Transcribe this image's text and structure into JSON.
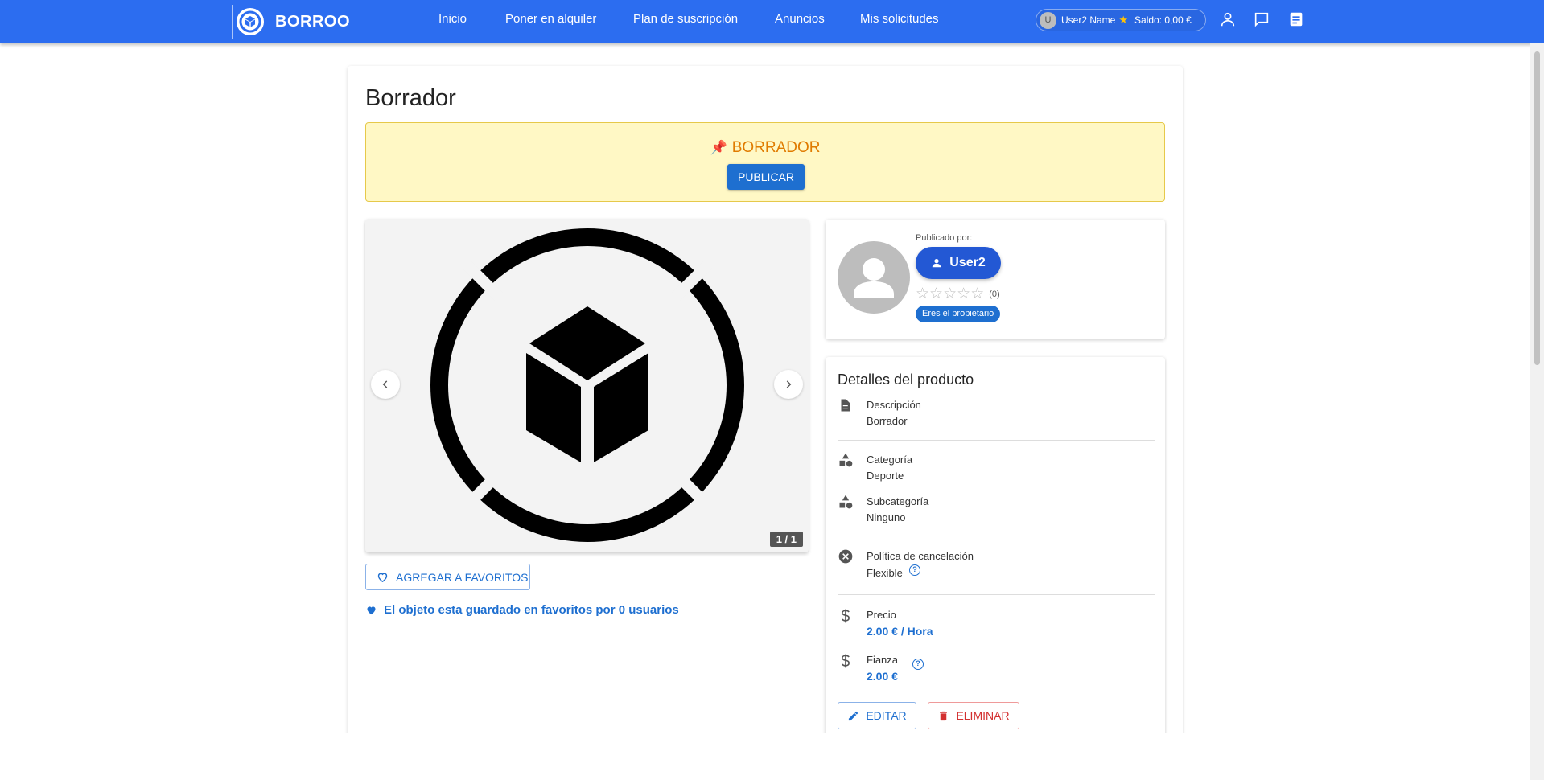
{
  "header": {
    "brand": "BORROO",
    "nav": [
      "Inicio",
      "Poner en alquiler",
      "Plan de suscripción",
      "Anuncios",
      "Mis solicitudes"
    ],
    "user_initial": "U",
    "user_name": "User2 Name",
    "balance": "Saldo: 0,00 €",
    "icons": [
      "person-icon",
      "chat-icon",
      "notes-icon"
    ]
  },
  "page": {
    "title": "Borrador",
    "draft_label": "BORRADOR",
    "publish_label": "PUBLICAR"
  },
  "carousel": {
    "counter": "1 / 1"
  },
  "favorites": {
    "button_label": "AGREGAR A FAVORITOS",
    "info": "El objeto esta guardado en favoritos por 0 usuarios"
  },
  "owner": {
    "published_by": "Publicado por:",
    "username": "User2",
    "rating": 0,
    "rating_count": "(0)",
    "badge": "Eres el propietario"
  },
  "details": {
    "title": "Detalles del producto",
    "description_label": "Descripción",
    "description_value": "Borrador",
    "category_label": "Categoría",
    "category_value": "Deporte",
    "subcategory_label": "Subcategoría",
    "subcategory_value": "Ninguno",
    "cancellation_label": "Política de cancelación",
    "cancellation_value": "Flexible",
    "price_label": "Precio",
    "price_value": "2.00 € / Hora",
    "deposit_label": "Fianza",
    "deposit_value": "2.00 €",
    "edit_label": "EDITAR",
    "delete_label": "ELIMINAR"
  },
  "colors": {
    "header": "#2c6df0",
    "accent": "#1e6fd0",
    "draft_bg": "#fff8c5",
    "draft_text": "#e07b00",
    "danger": "#d32f2f"
  }
}
